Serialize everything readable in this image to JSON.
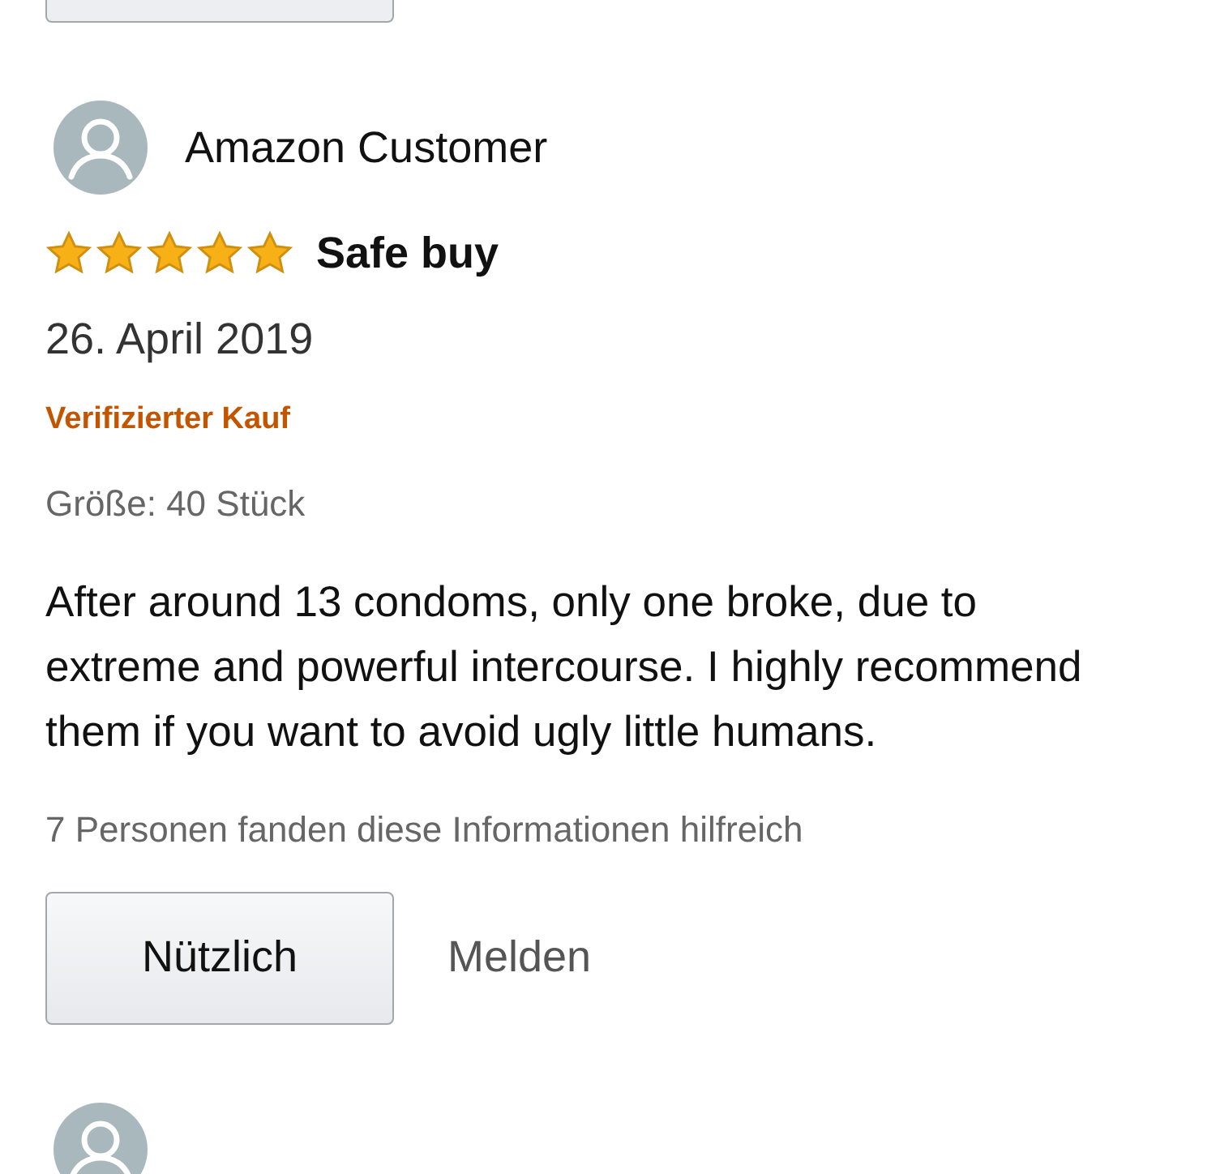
{
  "review": {
    "author": "Amazon Customer",
    "stars": 5,
    "title": "Safe buy",
    "date": "26. April 2019",
    "verified": "Verifizierter Kauf",
    "variant": "Größe: 40 Stück",
    "body": "After around 13 condoms, only one broke, due to extreme and powerful intercourse. I highly recommend them if you want to avoid ugly little humans.",
    "helpful_count": "7 Personen fanden diese Informationen hilfreich",
    "buttons": {
      "helpful": "Nützlich",
      "report": "Melden"
    }
  }
}
